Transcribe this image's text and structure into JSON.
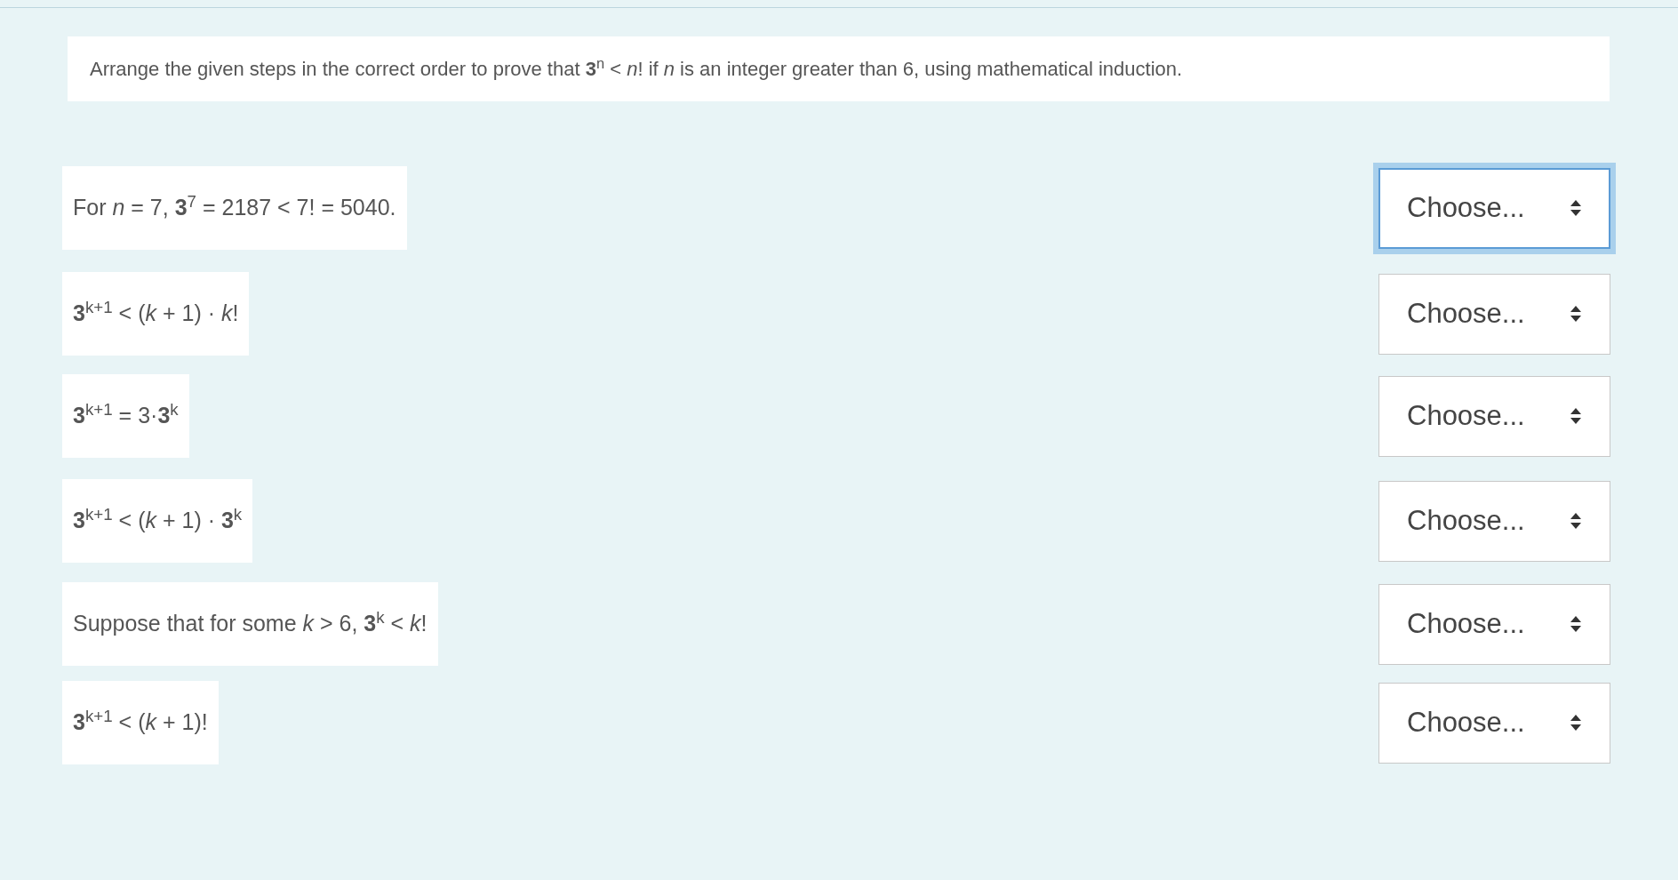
{
  "question": "Arrange the given steps in the correct order to prove that **3**$^{n}$ < *n*! if *n* is an integer greater than 6, using mathematical induction.",
  "steps": [
    {
      "text": "For *n* = 7, **3**$^{7}$ = 2187 < 7! = 5040.",
      "select": {
        "label": "Choose...",
        "focused": true
      }
    },
    {
      "text": "**3**$^{k+1}$ < (*k* + 1) · *k*!",
      "select": {
        "label": "Choose...",
        "focused": false
      }
    },
    {
      "text": "**3**$^{k+1}$ = 3·**3**$^{k}$",
      "select": {
        "label": "Choose...",
        "focused": false
      }
    },
    {
      "text": "**3**$^{k+1}$ < (*k* + 1) · **3**$^{k}$",
      "select": {
        "label": "Choose...",
        "focused": false
      }
    },
    {
      "text": "Suppose that for some *k* > 6, **3**$^{k}$ < *k*!",
      "select": {
        "label": "Choose...",
        "focused": false
      }
    },
    {
      "text": "**3**$^{k+1}$ < (*k* + 1)!",
      "select": {
        "label": "Choose...",
        "focused": false
      }
    }
  ]
}
